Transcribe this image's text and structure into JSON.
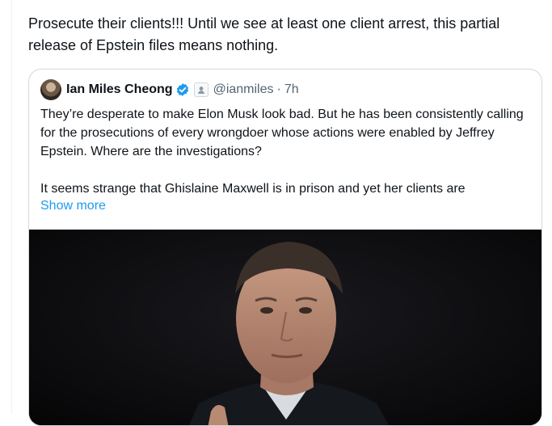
{
  "post": {
    "text": "Prosecute their clients!!! Until we see at least one client arrest, this partial release of Epstein files means nothing."
  },
  "quote": {
    "author_name": "Ian Miles Cheong",
    "handle": "@ianmiles",
    "separator": "·",
    "timestamp": "7h",
    "paragraph1": "They’re desperate to make Elon Musk look bad. But he has been consistently calling for the prosecutions of every wrongdoer whose actions were enabled by Jeffrey Epstein. Where are the investigations?",
    "paragraph2": "It seems strange that Ghislaine Maxwell is in prison and yet her clients are",
    "show_more": "Show more"
  },
  "colors": {
    "link": "#1d9bf0",
    "verified": "#1d9bf0",
    "muted_text": "#536471",
    "border": "#cfd9de"
  },
  "icons": {
    "verified": "verified-badge-icon",
    "affiliate": "affiliate-badge-icon"
  }
}
